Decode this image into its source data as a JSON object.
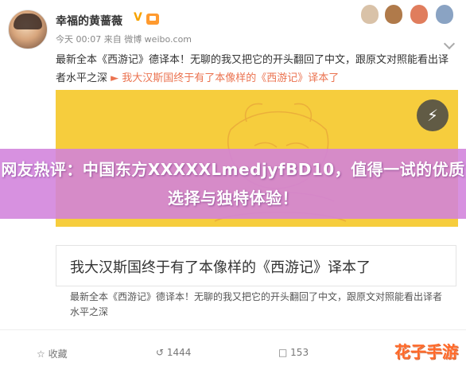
{
  "post": {
    "username": "幸福的黄蔷薇",
    "verified_mark": "V",
    "meta": "今天 00:07 来自 微博 weibo.com",
    "text": "最新全本《西游记》德译本！无聊的我又把它的开头翻回了中文，跟原文对照能看出译者水平之深",
    "link_text": "我大汉斯国终于有了本像样的《西游记》译本了"
  },
  "card": {
    "author": "幸福的黄蔷薇",
    "title": "我大汉斯国终于有了本像样的《西游记》译本了",
    "body": "最新全本《西游记》德译本！无聊的我又把它的开头翻回了中文，跟原文对照能看出译者水平之深"
  },
  "banner": {
    "text": "网友热评：中国东方XXXXXLmedjyfBD10，值得一试的优质选择与独特体验！"
  },
  "actions": {
    "collect": "收藏",
    "repost_count": "1444",
    "comment_count": "153"
  },
  "watermark": "花子手游",
  "colors": {
    "card_bg": "#f6cd3d",
    "banner_bg": "#d282dc",
    "link": "#eb7350",
    "watermark": "#ff6a2a"
  },
  "icons": [
    "chevron-down-icon",
    "play-icon",
    "star-icon",
    "repost-icon",
    "comment-icon"
  ]
}
